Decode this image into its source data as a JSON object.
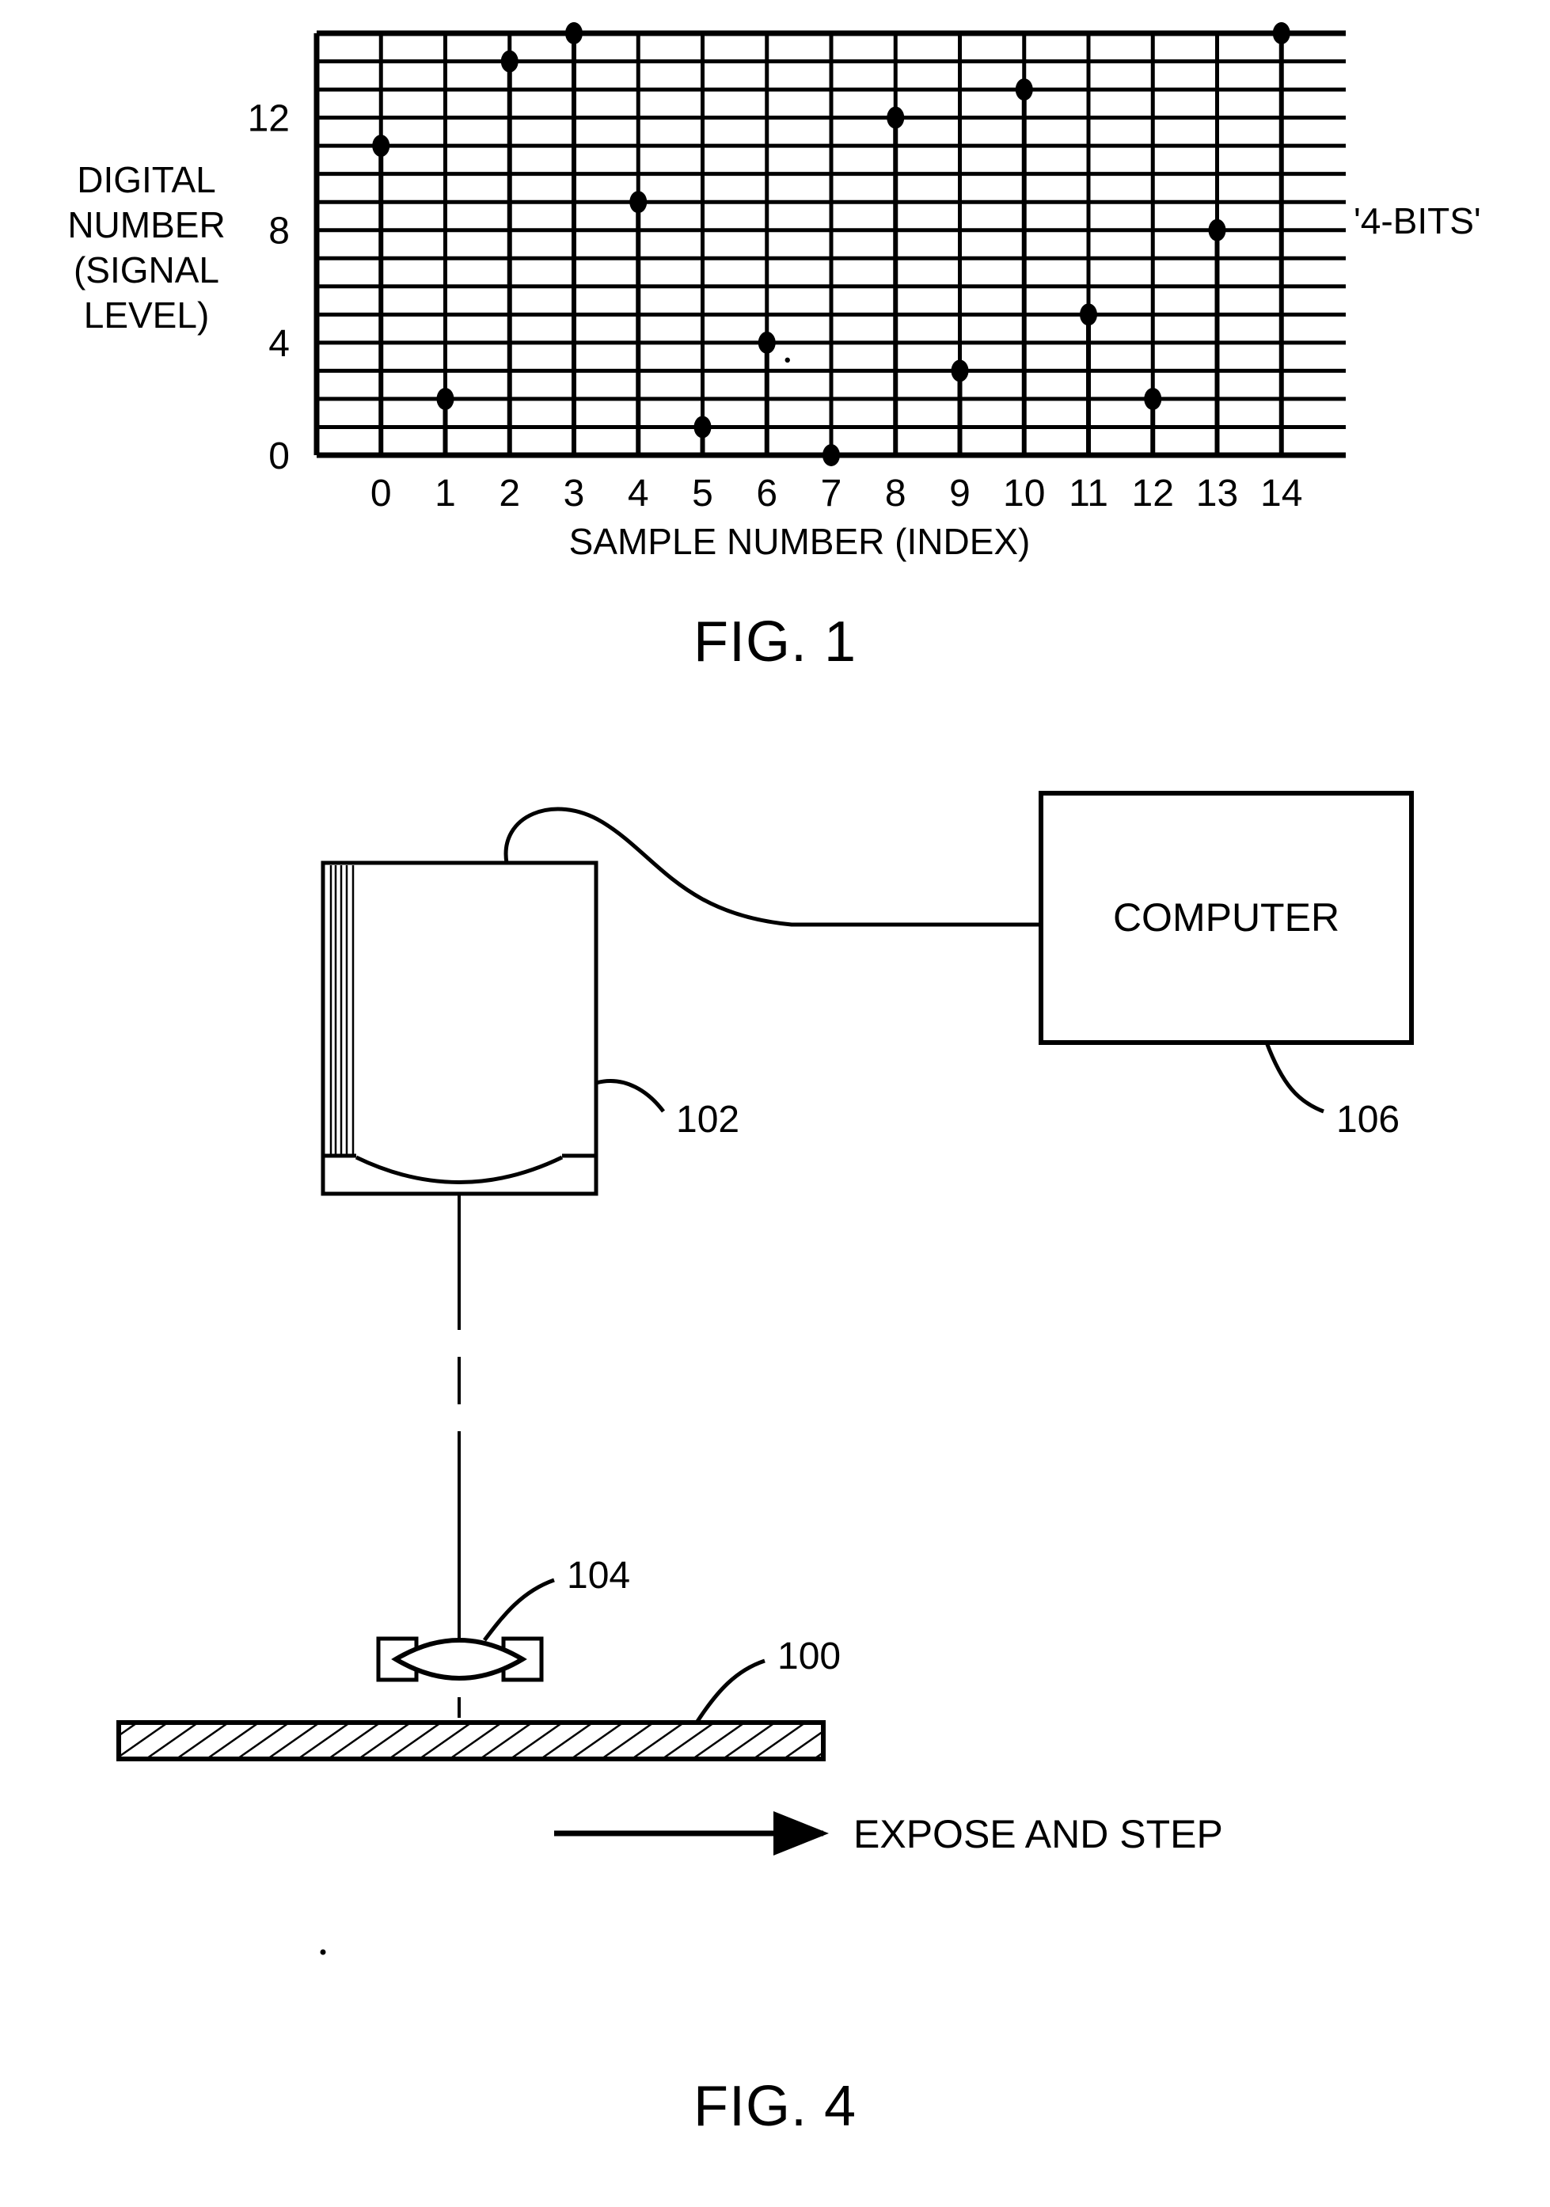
{
  "document": {
    "kind": "patent-figure-sheet",
    "figures": [
      "FIG. 1",
      "FIG. 4"
    ]
  },
  "fig1": {
    "caption": "FIG. 1",
    "y_axis_title_lines": [
      "DIGITAL",
      "NUMBER",
      "(SIGNAL",
      "LEVEL)"
    ],
    "x_axis_title": "SAMPLE NUMBER (INDEX)",
    "annotation": "'4-BITS'",
    "y_tick_labels": [
      "0",
      "4",
      "8",
      "12"
    ],
    "x_tick_labels": [
      "0",
      "1",
      "2",
      "3",
      "4",
      "5",
      "6",
      "7",
      "8",
      "9",
      "10",
      "11",
      "12",
      "13",
      "14"
    ]
  },
  "chart_data": {
    "type": "scatter",
    "title": "FIG. 1",
    "xlabel": "SAMPLE NUMBER (INDEX)",
    "ylabel": "DIGITAL NUMBER (SIGNAL LEVEL)",
    "annotation": "'4-BITS'",
    "x": [
      0,
      1,
      2,
      3,
      4,
      5,
      6,
      7,
      8,
      9,
      10,
      11,
      12,
      13,
      14
    ],
    "values": [
      11,
      2,
      14,
      15,
      9,
      1,
      4,
      0,
      12,
      3,
      13,
      5,
      2,
      8,
      15
    ],
    "categories": [
      "0",
      "1",
      "2",
      "3",
      "4",
      "5",
      "6",
      "7",
      "8",
      "9",
      "10",
      "11",
      "12",
      "13",
      "14"
    ],
    "xlim": [
      -0.6,
      14.6
    ],
    "ylim": [
      0,
      15
    ],
    "ytick_values": [
      0,
      4,
      8,
      12
    ],
    "ytick_labels": [
      "0",
      "4",
      "8",
      "12"
    ],
    "grid": true,
    "grid_y_step": 1,
    "grid_x_step": 1,
    "marker": "filled-circle",
    "stems": true,
    "legend": "none",
    "series": [
      {
        "name": "digital number",
        "values": [
          11,
          2,
          14,
          15,
          9,
          1,
          4,
          0,
          12,
          3,
          13,
          5,
          2,
          8,
          15
        ]
      }
    ]
  },
  "fig4": {
    "caption": "FIG. 4",
    "computer_label": "COMPUTER",
    "expose_label": "EXPOSE AND STEP",
    "ref_numerals": {
      "substrate": "100",
      "camera": "102",
      "lens": "104",
      "computer": "106"
    }
  }
}
